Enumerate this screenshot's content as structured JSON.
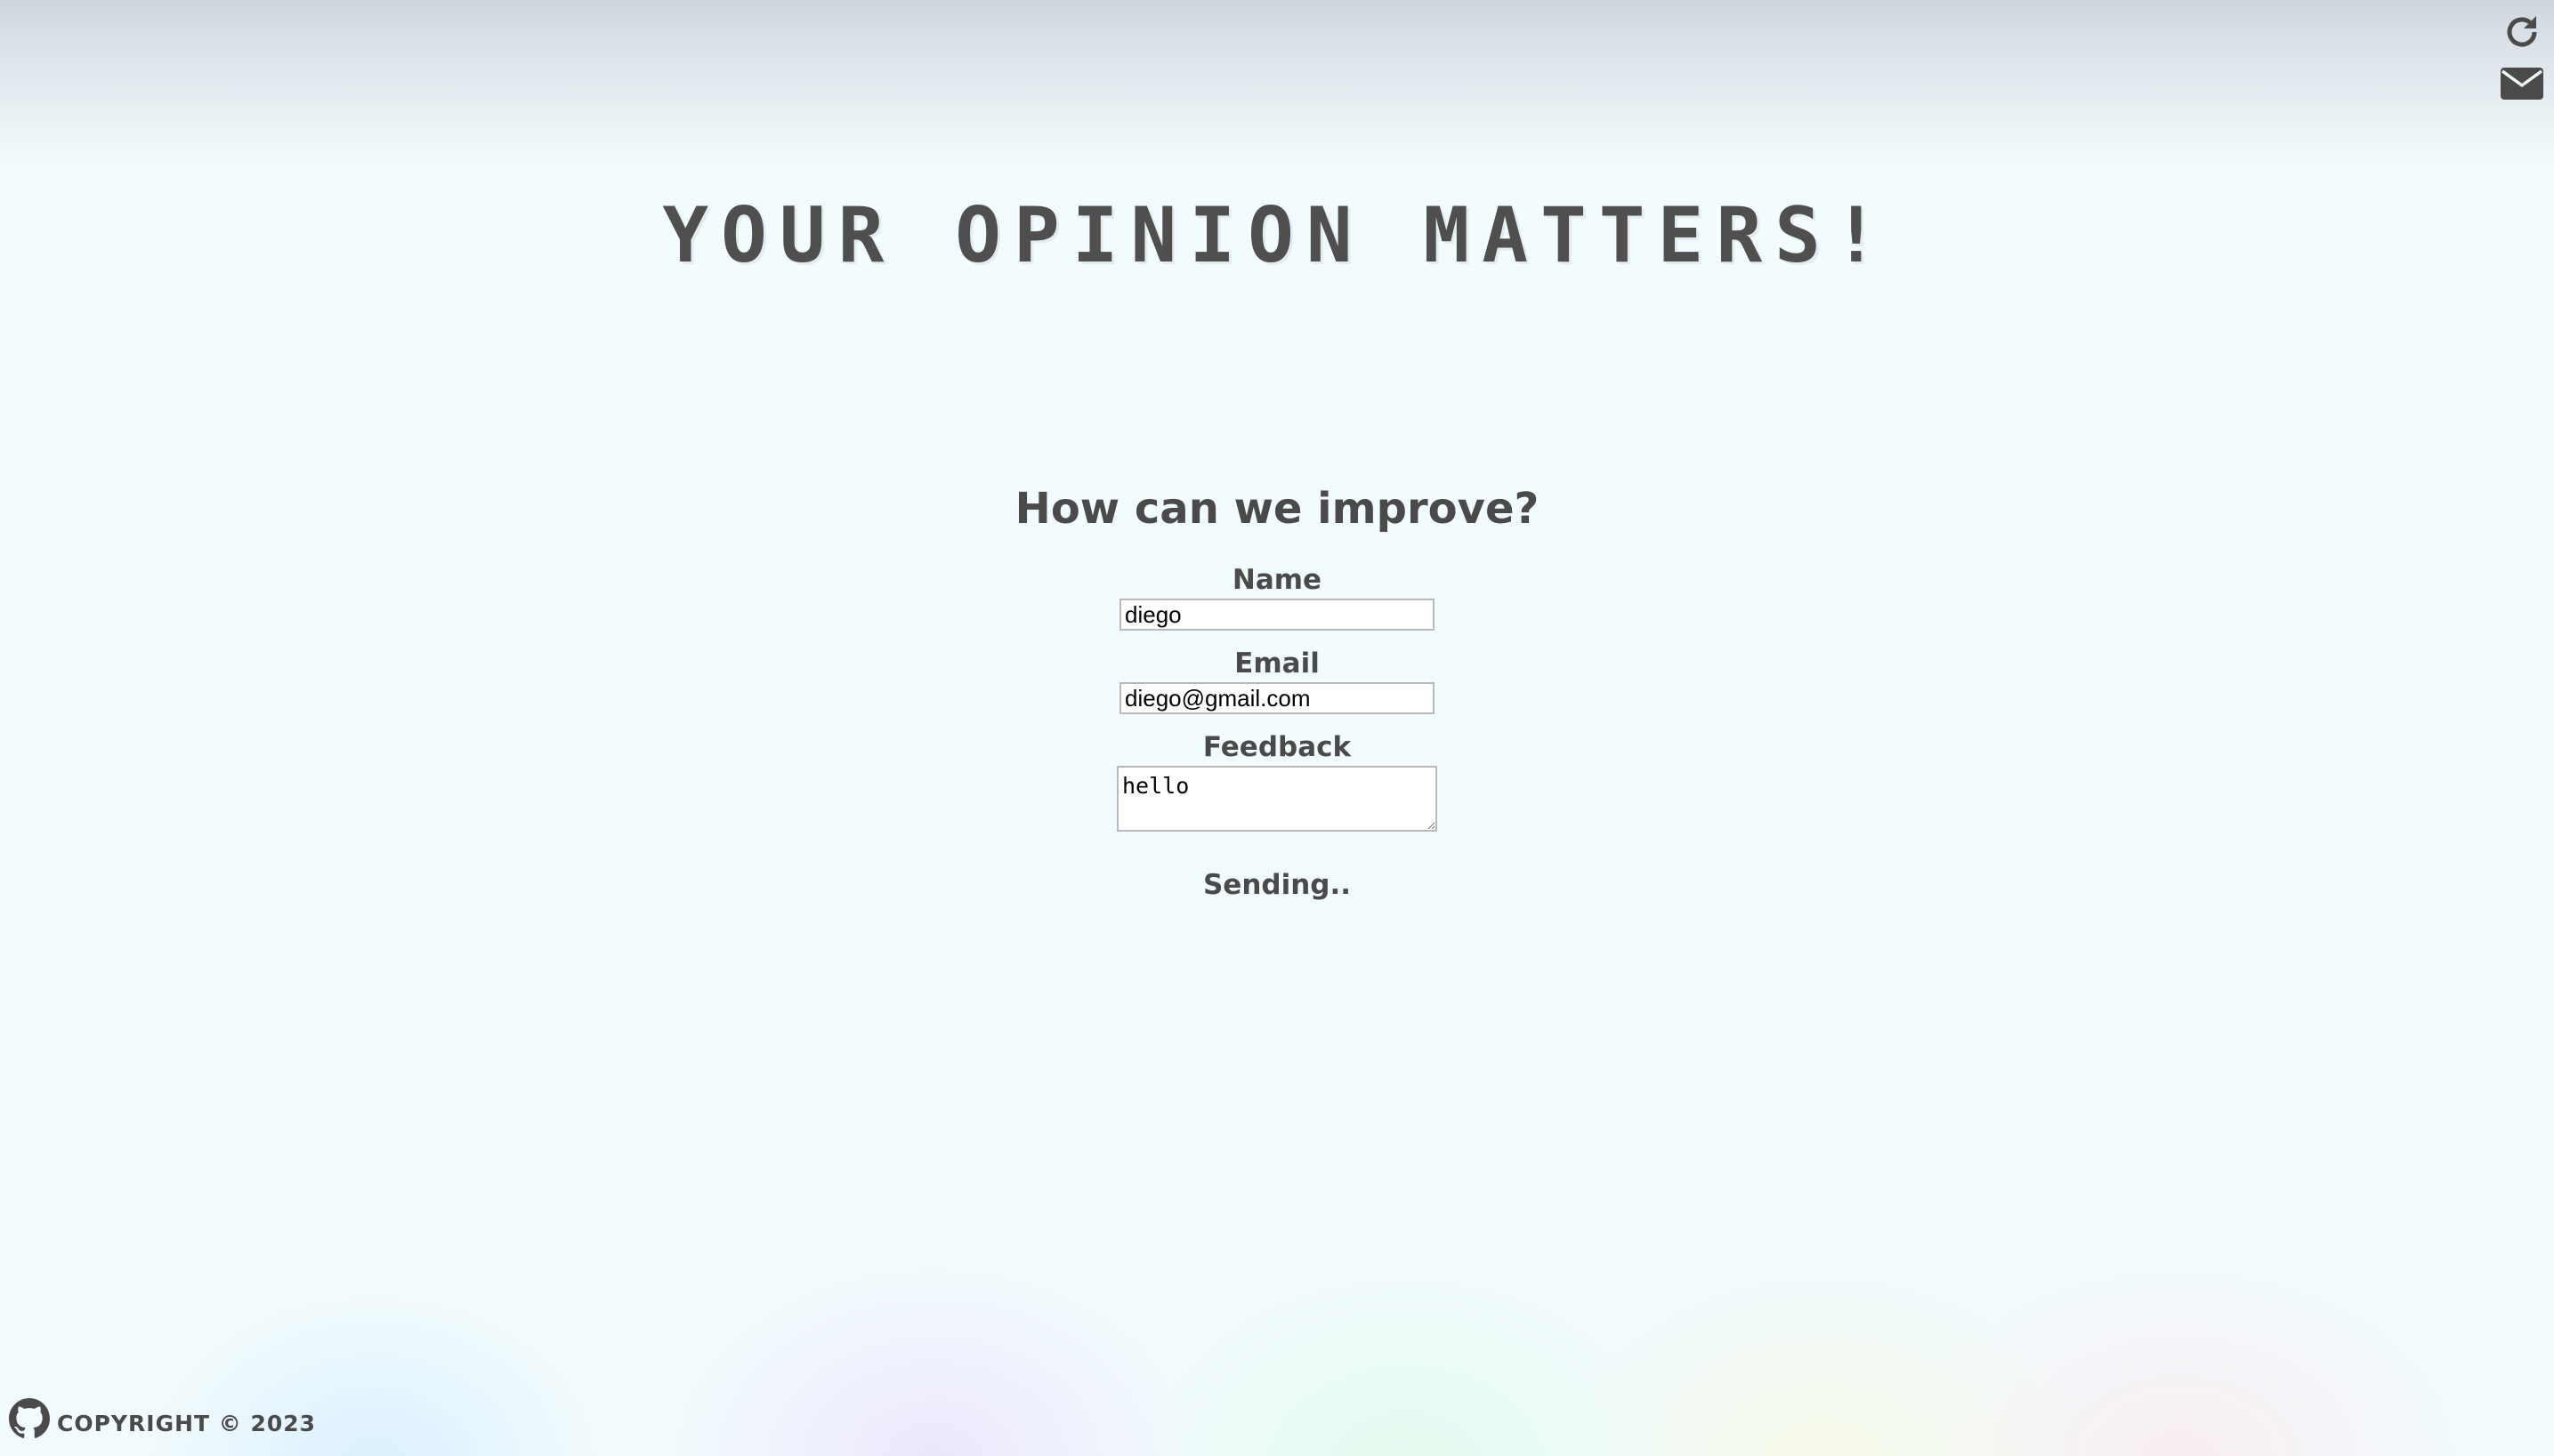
{
  "header": {
    "title": "YOUR OPINION MATTERS!",
    "icons": [
      "refresh-icon",
      "mail-icon"
    ]
  },
  "form": {
    "heading": "How can we improve?",
    "name_label": "Name",
    "name_value": "diego",
    "email_label": "Email",
    "email_value": "diego@gmail.com",
    "feedback_label": "Feedback",
    "feedback_value": "hello",
    "status": "Sending.."
  },
  "footer": {
    "icon": "github-icon",
    "copyright": "COPYRIGHT © 2023"
  }
}
